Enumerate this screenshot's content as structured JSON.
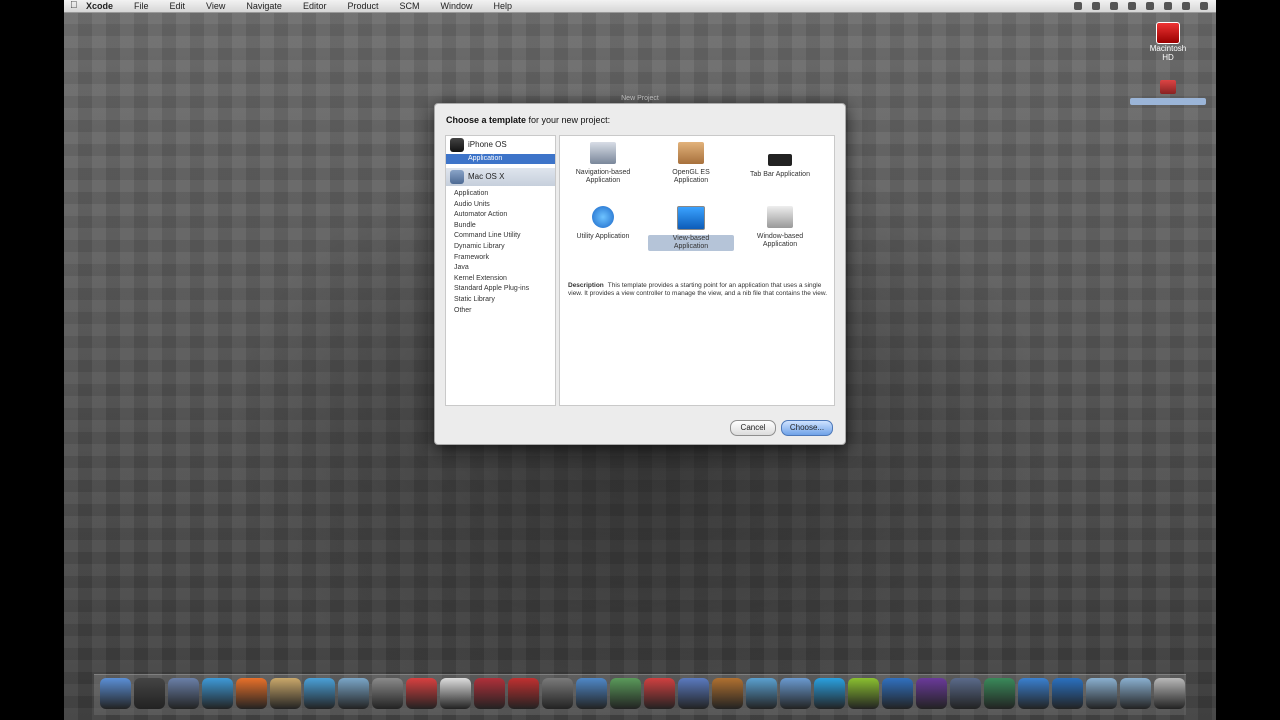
{
  "menubar": {
    "apple_icon": "apple-icon",
    "items": [
      "Xcode",
      "File",
      "Edit",
      "View",
      "Navigate",
      "Editor",
      "Product",
      "SCM",
      "Window",
      "Help"
    ],
    "status_icons": [
      "dropbox-icon",
      "alert-icon",
      "phone-icon",
      "battery-icon",
      "wifi-icon",
      "volume-icon",
      "clock-icon",
      "spotlight-icon"
    ]
  },
  "desktop": {
    "icon1_label": "Macintosh HD",
    "icon2_label": ""
  },
  "dialog": {
    "title": "New Project",
    "prompt_bold": "Choose a template",
    "prompt_rest": " for your new project:",
    "groups": [
      {
        "label": "iPhone OS",
        "sub": "Application",
        "icon": "iphone-icon"
      },
      {
        "label": "Mac OS X",
        "icon": "mac-icon"
      }
    ],
    "mac_items": [
      "Application",
      "Audio Units",
      "Automator Action",
      "Bundle",
      "Command Line Utility",
      "Dynamic Library",
      "Framework",
      "Java",
      "Kernel Extension",
      "Standard Apple Plug-ins",
      "Static Library",
      "Other"
    ],
    "templates": [
      {
        "line1": "Navigation-based",
        "line2": "Application",
        "icon": "navigation-app-icon"
      },
      {
        "line1": "OpenGL ES",
        "line2": "Application",
        "icon": "opengl-app-icon"
      },
      {
        "line1": "Tab Bar Application",
        "line2": "",
        "icon": "tab-bar-app-icon"
      },
      {
        "line1": "Utility Application",
        "line2": "",
        "icon": "utility-app-icon"
      },
      {
        "line1": "View-based",
        "line2": "Application",
        "icon": "view-app-icon"
      },
      {
        "line1": "Window-based",
        "line2": "Application",
        "icon": "window-app-icon"
      }
    ],
    "selected_template": "View-based",
    "description_label": "Description",
    "description_text": "This template provides a starting point for an application that uses a single view. It provides a view controller to manage the view, and a nib file that contains the view.",
    "cancel_label": "Cancel",
    "choose_label": "Choose..."
  },
  "dock": {
    "apps": [
      "finder-icon",
      "dashboard-icon",
      "mail-icon",
      "safari-icon",
      "firefox-icon",
      "preview-icon",
      "itunes-icon",
      "iphoto-icon",
      "xcode-icon",
      "ical-icon",
      "textedit-icon",
      "photo-booth-icon",
      "calendar-icon",
      "system-preferences-icon",
      "utility-icon",
      "chart-icon",
      "flash-icon",
      "games-icon",
      "automator-icon",
      "app-icon",
      "ichat-icon",
      "skype-icon",
      "dreamweaver-icon",
      "photoshop-icon",
      "premiere-icon",
      "imovie-icon",
      "time-machine-icon",
      "app-store-icon",
      "network-icon",
      "folder-icon",
      "downloads-icon",
      "trash-icon"
    ]
  }
}
